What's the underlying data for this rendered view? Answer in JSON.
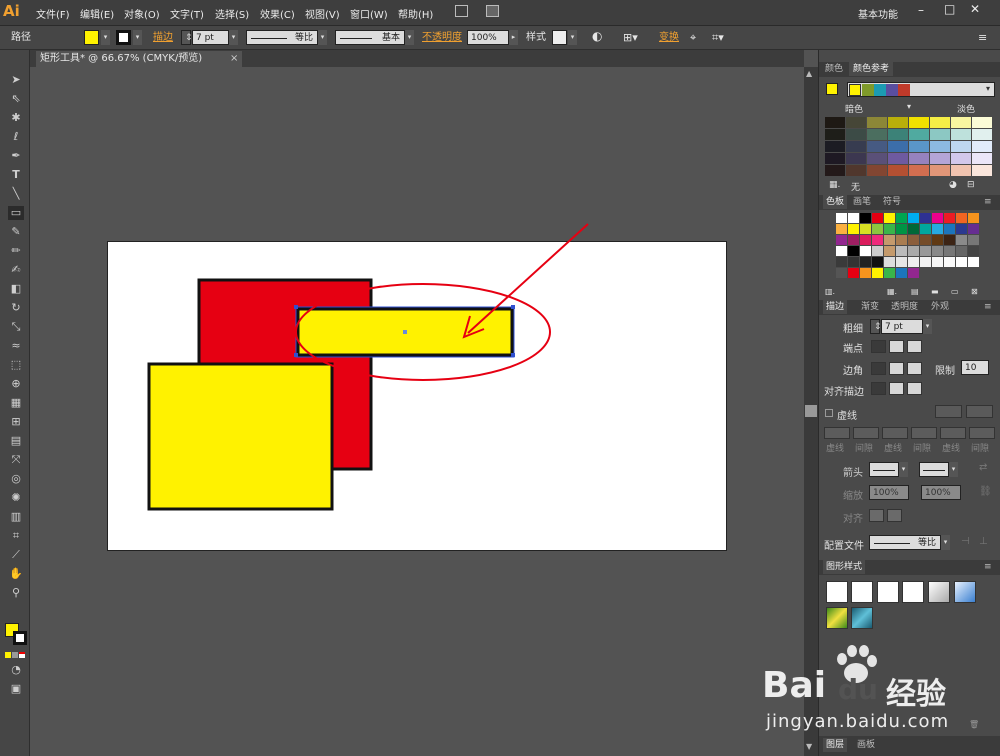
{
  "app": {
    "logo": "Ai",
    "workspace": "基本功能"
  },
  "menu": [
    "文件(F)",
    "编辑(E)",
    "对象(O)",
    "文字(T)",
    "选择(S)",
    "效果(C)",
    "视图(V)",
    "窗口(W)",
    "帮助(H)"
  ],
  "control": {
    "selection_label": "路径",
    "stroke_label": "描边",
    "stroke_weight": "7 pt",
    "profile_label": "等比",
    "brush_label": "基本",
    "opacity_label": "不透明度",
    "opacity_value": "100%",
    "style_label": "样式",
    "transform_label": "变换",
    "fill_color": "#fff200"
  },
  "document": {
    "tab_title": "矩形工具* @ 66.67% (CMYK/预览)"
  },
  "panels": {
    "color_tabs": [
      "颜色",
      "颜色参考"
    ],
    "guide_left": "暗色",
    "guide_right": "淡色",
    "guide_none": "无",
    "swatch_tabs": [
      "色板",
      "画笔",
      "符号"
    ],
    "stroke_tabs": [
      "描边",
      "渐变",
      "透明度",
      "外观"
    ],
    "stroke": {
      "weight_label": "粗细",
      "weight_value": "7 pt",
      "cap_label": "端点",
      "corner_label": "边角",
      "limit_label": "限制",
      "limit_value": "10",
      "align_label": "对齐描边",
      "dash_label": "虚线",
      "dash_fields": [
        "虚线",
        "间隙",
        "虚线",
        "间隙",
        "虚线",
        "间隙"
      ],
      "arrow_label": "箭头",
      "scale_label": "缩放",
      "scale_values": [
        "100%",
        "100%"
      ],
      "arrow_align_label": "对齐",
      "profile_label": "配置文件",
      "profile_value": "等比"
    },
    "graphic_styles_title": "图形样式",
    "layer_tabs": [
      "图层",
      "画板"
    ]
  },
  "watermark": {
    "brand": "Bai",
    "brand2": "du",
    "cn": "经验",
    "url": "jingyan.baidu.com"
  },
  "colors": {
    "red": "#e60012",
    "yellow": "#fff200",
    "annotation": "#e60012",
    "selection": "#3050d0"
  }
}
